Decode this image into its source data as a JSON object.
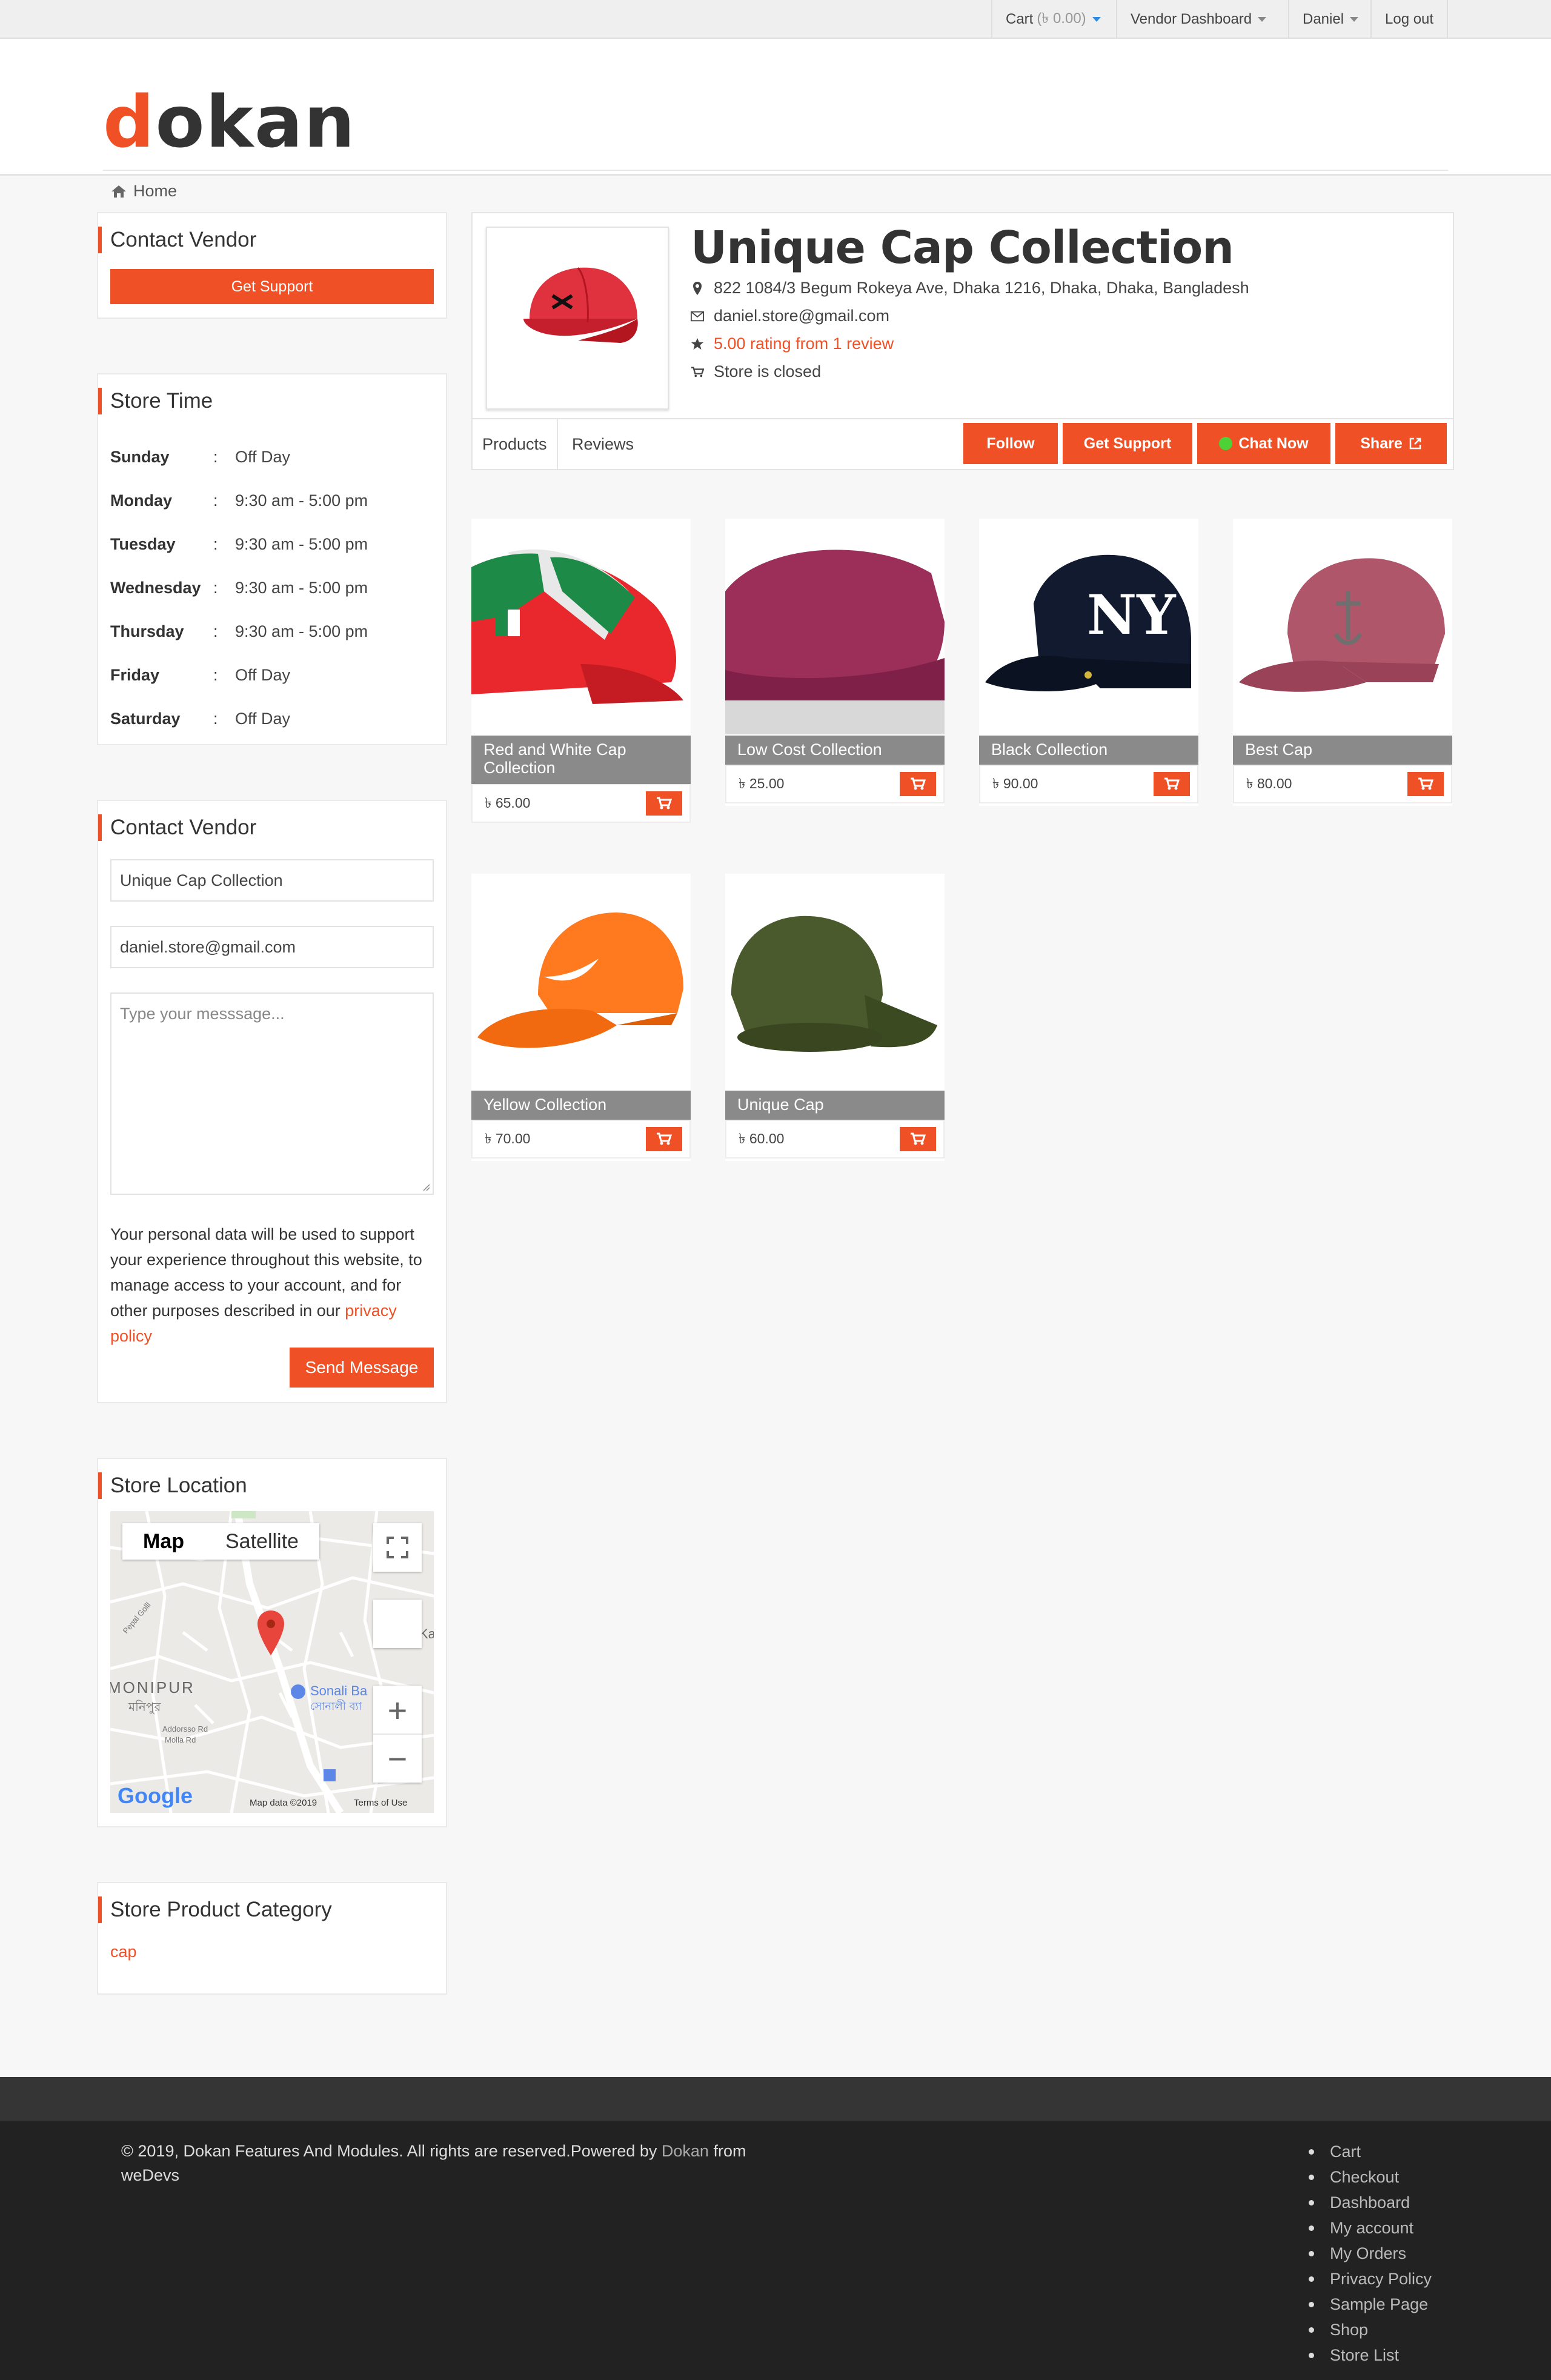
{
  "topbar": {
    "cart_label": "Cart",
    "cart_amount": "(৳ 0.00)",
    "vendor_dashboard": "Vendor Dashboard",
    "user": "Daniel",
    "logout": "Log out"
  },
  "header": {
    "logo_first": "d",
    "logo_rest": "okan",
    "breadcrumb": "Home"
  },
  "sidebar": {
    "contact_vendor_title": "Contact Vendor",
    "get_support": "Get Support",
    "store_time_title": "Store Time",
    "hours": [
      {
        "day": "Sunday",
        "sep": ":",
        "time": "Off Day"
      },
      {
        "day": "Monday",
        "sep": ":",
        "time": "9:30 am - 5:00 pm"
      },
      {
        "day": "Tuesday",
        "sep": ":",
        "time": "9:30 am - 5:00 pm"
      },
      {
        "day": "Wednesday",
        "sep": ":",
        "time": "9:30 am - 5:00 pm"
      },
      {
        "day": "Thursday",
        "sep": ":",
        "time": "9:30 am - 5:00 pm"
      },
      {
        "day": "Friday",
        "sep": ":",
        "time": "Off Day"
      },
      {
        "day": "Saturday",
        "sep": ":",
        "time": "Off Day"
      }
    ],
    "contact_form_title": "Contact Vendor",
    "name_value": "Unique Cap Collection",
    "email_value": "daniel.store@gmail.com",
    "message_placeholder": "Type your messsage...",
    "privacy_text": "Your personal data will be used to support your experience throughout this website, to manage access to your account, and for other purposes described in our",
    "privacy_link": "privacy policy",
    "send_message": "Send Message",
    "location_title": "Store Location",
    "map": {
      "tab_map": "Map",
      "tab_satellite": "Satellite",
      "label_monipur": "MONIPUR",
      "label_monipur_bn": "মনিপুর",
      "label_sonali": "Sonali Ba",
      "label_sonali_bn": "সোনালী ব্যা",
      "label_road1": "Addorsso Rd",
      "label_road2": "Molla Rd",
      "label_ka": "Ka",
      "label_pepal": "Pepal Golli",
      "google": "Google",
      "map_data": "Map data ©2019",
      "terms": "Terms of Use",
      "zoom_in": "+",
      "zoom_out": "−"
    },
    "category_title": "Store Product Category",
    "category_item": "cap"
  },
  "store": {
    "name": "Unique Cap Collection",
    "address": "822 1084/3 Begum Rokeya Ave, Dhaka 1216, Dhaka, Dhaka, Bangladesh",
    "email": "daniel.store@gmail.com",
    "rating": "5.00 rating from 1 review",
    "status": "Store is closed",
    "tab_products": "Products",
    "tab_reviews": "Reviews",
    "btn_follow": "Follow",
    "btn_support": "Get Support",
    "btn_chat": "Chat Now",
    "btn_share": "Share"
  },
  "products": [
    {
      "title": "Red and White Cap Collection",
      "price": "৳ 65.00"
    },
    {
      "title": "Low Cost Collection",
      "price": "৳ 25.00"
    },
    {
      "title": "Black Collection",
      "price": "৳ 90.00"
    },
    {
      "title": "Best Cap",
      "price": "৳ 80.00"
    },
    {
      "title": "Yellow Collection",
      "price": "৳ 70.00"
    },
    {
      "title": "Unique Cap",
      "price": "৳ 60.00"
    }
  ],
  "footer": {
    "copyright": "© 2019, Dokan Features And Modules. All rights are reserved.Powered by",
    "powered_link": "Dokan",
    "from": "from",
    "wedevs": "weDevs",
    "links": [
      "Cart",
      "Checkout",
      "Dashboard",
      "My account",
      "My Orders",
      "Privacy Policy",
      "Sample Page",
      "Shop",
      "Store List"
    ]
  },
  "colors": {
    "accent": "#f05025",
    "chat_dot": "#4cd137",
    "footer_bg": "#222222"
  }
}
